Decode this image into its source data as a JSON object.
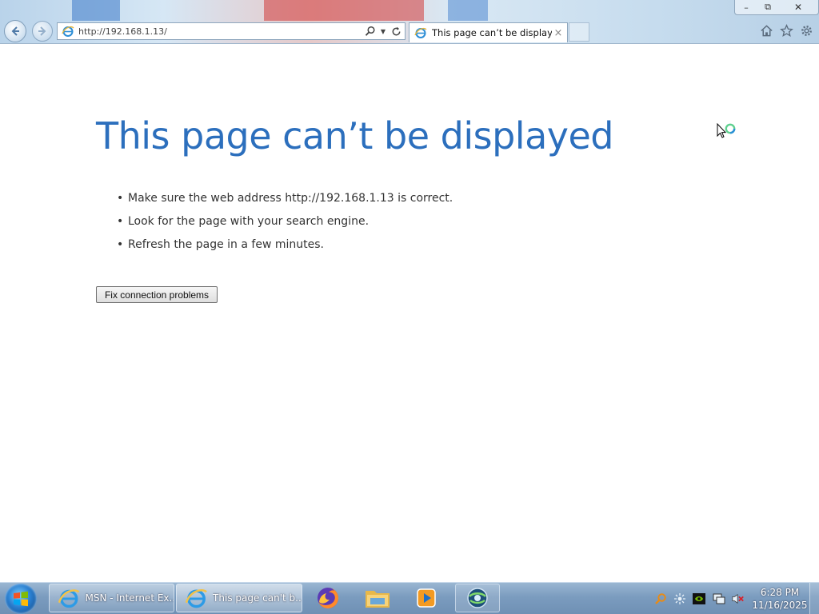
{
  "browser": {
    "address_url": "http://192.168.1.13/",
    "tab_title": "This page can’t be displayed",
    "tab_close_glyph": "×",
    "window_controls": {
      "minimize": "–",
      "maximize": "⧉",
      "close": "✕"
    },
    "icons": [
      "back-icon",
      "forward-icon",
      "ie-page-icon",
      "search-icon",
      "dropdown-icon",
      "refresh-icon",
      "home-icon",
      "favorites-star-icon",
      "settings-gear-icon"
    ]
  },
  "page": {
    "title": "This page can’t be displayed",
    "bullet_glyph": "•",
    "suggestions": [
      "Make sure the web address http://192.168.1.13 is correct.",
      "Look for the page with your search engine.",
      "Refresh the page in a few minutes."
    ],
    "fix_button_label": "Fix connection problems",
    "title_color": "#2c6fbd"
  },
  "taskbar": {
    "items": [
      {
        "label": "MSN - Internet Ex...",
        "icon": "internet-explorer-icon"
      },
      {
        "label": "This page can't b...",
        "icon": "internet-explorer-icon"
      }
    ],
    "pinned": [
      "firefox-icon",
      "file-explorer-icon",
      "media-player-icon",
      "app-globe-icon"
    ],
    "tray_icons": [
      "search-tray-icon",
      "network-activity-icon",
      "nvidia-icon",
      "network-icon",
      "volume-muted-icon"
    ],
    "clock": {
      "time": "6:28 PM",
      "date": "11/16/2025"
    }
  }
}
